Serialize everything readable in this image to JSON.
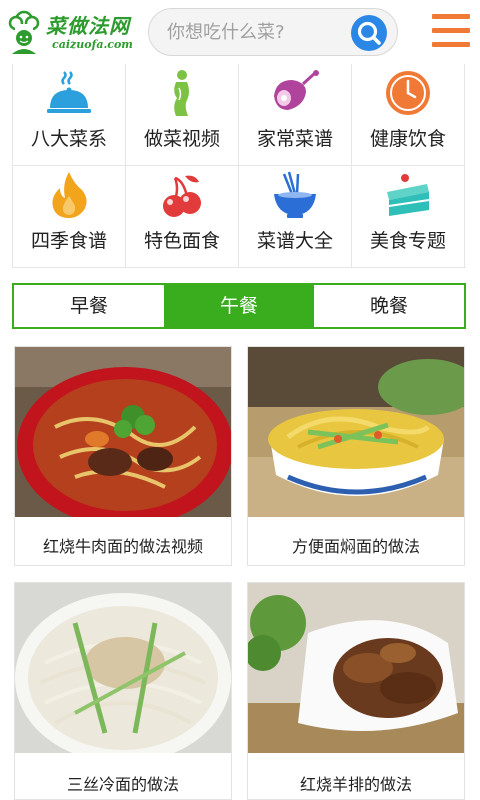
{
  "header": {
    "logo_text": "菜做法网",
    "logo_url": "caizuofa.com",
    "search": {
      "placeholder": "你想吃什么菜?"
    }
  },
  "categories": [
    {
      "label": "八大菜系",
      "icon": "serving-cloche-icon",
      "color": "#2ba0dc"
    },
    {
      "label": "做菜视频",
      "icon": "figure-icon",
      "color": "#7dc243"
    },
    {
      "label": "家常菜谱",
      "icon": "ham-icon",
      "color": "#b0439c"
    },
    {
      "label": "健康饮食",
      "icon": "clock-icon",
      "color": "#f07a35"
    },
    {
      "label": "四季食谱",
      "icon": "flame-icon",
      "color": "#f2a51c"
    },
    {
      "label": "特色面食",
      "icon": "cherries-icon",
      "color": "#e23b3b"
    },
    {
      "label": "菜谱大全",
      "icon": "noodle-bowl-icon",
      "color": "#2b6fd6"
    },
    {
      "label": "美食专题",
      "icon": "cake-slice-icon",
      "color": "#2ec0b8"
    }
  ],
  "meal_tabs": [
    {
      "label": "早餐"
    },
    {
      "label": "午餐",
      "active": true
    },
    {
      "label": "晚餐"
    }
  ],
  "recipes": [
    {
      "title": "红烧牛肉面的做法视频"
    },
    {
      "title": "方便面焖面的做法"
    },
    {
      "title": "三丝冷面的做法"
    },
    {
      "title": "红烧羊排的做法"
    }
  ],
  "colors": {
    "accent_green": "#3aad1f",
    "menu_orange": "#f07a35",
    "search_blue": "#2b87e6"
  }
}
